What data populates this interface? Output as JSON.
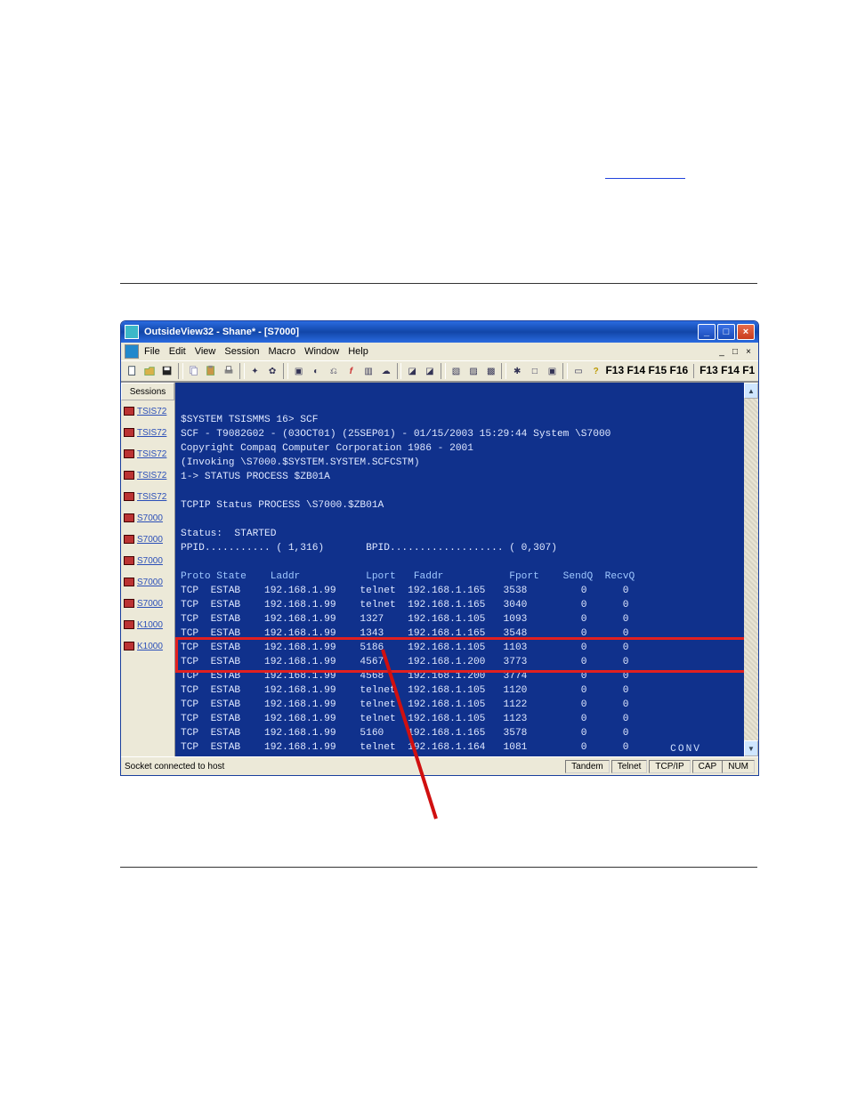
{
  "window": {
    "title": "OutsideView32 - Shane* - [S7000]"
  },
  "menu": {
    "items": [
      "File",
      "Edit",
      "View",
      "Session",
      "Macro",
      "Window",
      "Help"
    ]
  },
  "fkeys": {
    "left": "F13 F14 F15 F16",
    "right": "F13 F14 F1"
  },
  "sidebar": {
    "header": "Sessions",
    "items": [
      {
        "label": "TSIS72"
      },
      {
        "label": "TSIS72"
      },
      {
        "label": "TSIS72"
      },
      {
        "label": "TSIS72"
      },
      {
        "label": "TSIS72"
      },
      {
        "label": "S7000"
      },
      {
        "label": "S7000"
      },
      {
        "label": "S7000"
      },
      {
        "label": "S7000"
      },
      {
        "label": "S7000"
      },
      {
        "label": "K1000"
      },
      {
        "label": "K1000"
      }
    ]
  },
  "terminal": {
    "lines": [
      "$SYSTEM TSISMMS 16> SCF",
      "SCF - T9082G02 - (03OCT01) (25SEP01) - 01/15/2003 15:29:44 System \\S7000",
      "Copyright Compaq Computer Corporation 1986 - 2001",
      "(Invoking \\S7000.$SYSTEM.SYSTEM.SCFCSTM)",
      "1-> STATUS PROCESS $ZB01A",
      "",
      "TCPIP Status PROCESS \\S7000.$ZB01A",
      "",
      "Status:  STARTED",
      "PPID........... ( 1,316)       BPID................... ( 0,307)",
      ""
    ],
    "columns": "Proto State    Laddr           Lport   Faddr           Fport    SendQ  RecvQ",
    "rows": [
      {
        "proto": "TCP",
        "state": "ESTAB",
        "laddr": "192.168.1.99",
        "lport": "telnet",
        "faddr": "192.168.1.165",
        "fport": "3538",
        "sendq": "0",
        "recvq": "0"
      },
      {
        "proto": "TCP",
        "state": "ESTAB",
        "laddr": "192.168.1.99",
        "lport": "telnet",
        "faddr": "192.168.1.165",
        "fport": "3040",
        "sendq": "0",
        "recvq": "0"
      },
      {
        "proto": "TCP",
        "state": "ESTAB",
        "laddr": "192.168.1.99",
        "lport": "1327",
        "faddr": "192.168.1.105",
        "fport": "1093",
        "sendq": "0",
        "recvq": "0"
      },
      {
        "proto": "TCP",
        "state": "ESTAB",
        "laddr": "192.168.1.99",
        "lport": "1343",
        "faddr": "192.168.1.165",
        "fport": "3548",
        "sendq": "0",
        "recvq": "0"
      },
      {
        "proto": "TCP",
        "state": "ESTAB",
        "laddr": "192.168.1.99",
        "lport": "5186",
        "faddr": "192.168.1.105",
        "fport": "1103",
        "sendq": "0",
        "recvq": "0"
      },
      {
        "proto": "TCP",
        "state": "ESTAB",
        "laddr": "192.168.1.99",
        "lport": "4567",
        "faddr": "192.168.1.200",
        "fport": "3773",
        "sendq": "0",
        "recvq": "0"
      },
      {
        "proto": "TCP",
        "state": "ESTAB",
        "laddr": "192.168.1.99",
        "lport": "4568",
        "faddr": "192.168.1.200",
        "fport": "3774",
        "sendq": "0",
        "recvq": "0"
      },
      {
        "proto": "TCP",
        "state": "ESTAB",
        "laddr": "192.168.1.99",
        "lport": "telnet",
        "faddr": "192.168.1.105",
        "fport": "1120",
        "sendq": "0",
        "recvq": "0"
      },
      {
        "proto": "TCP",
        "state": "ESTAB",
        "laddr": "192.168.1.99",
        "lport": "telnet",
        "faddr": "192.168.1.105",
        "fport": "1122",
        "sendq": "0",
        "recvq": "0"
      },
      {
        "proto": "TCP",
        "state": "ESTAB",
        "laddr": "192.168.1.99",
        "lport": "telnet",
        "faddr": "192.168.1.105",
        "fport": "1123",
        "sendq": "0",
        "recvq": "0"
      },
      {
        "proto": "TCP",
        "state": "ESTAB",
        "laddr": "192.168.1.99",
        "lport": "5160",
        "faddr": "192.168.1.165",
        "fport": "3578",
        "sendq": "0",
        "recvq": "0"
      },
      {
        "proto": "TCP",
        "state": "ESTAB",
        "laddr": "192.168.1.99",
        "lport": "telnet",
        "faddr": "192.168.1.164",
        "fport": "1081",
        "sendq": "0",
        "recvq": "0"
      }
    ],
    "conv": "CONV"
  },
  "statusbar": {
    "msg": "Socket connected to host",
    "cells": [
      "Tandem",
      "Telnet",
      "TCP/IP",
      "CAP",
      "NUM"
    ]
  }
}
